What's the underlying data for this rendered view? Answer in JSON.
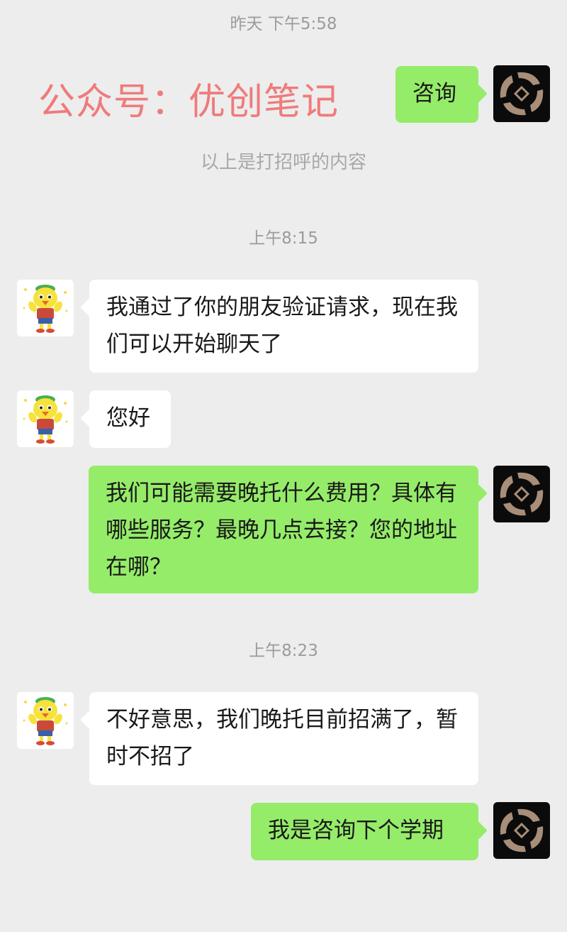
{
  "timestamps": {
    "t1": "昨天 下午5:58",
    "t2": "上午8:15",
    "t3": "上午8:23"
  },
  "watermark": "公众号：优创笔记",
  "system_note": "以上是打招呼的内容",
  "messages": [
    {
      "side": "right",
      "text": "咨询"
    },
    {
      "side": "left",
      "text": "我通过了你的朋友验证请求，现在我们可以开始聊天了"
    },
    {
      "side": "left",
      "text": "您好"
    },
    {
      "side": "right",
      "text": "我们可能需要晚托什么费用？具体有哪些服务？最晚几点去接？您的地址在哪？"
    },
    {
      "side": "left",
      "text": "不好意思，我们晚托目前招满了，暂时不招了"
    },
    {
      "side": "right",
      "text": "我是咨询下个学期"
    }
  ],
  "avatars": {
    "self": "ninja-logo-icon",
    "contact": "cartoon-chick-mascot-icon"
  },
  "colors": {
    "background": "#ededed",
    "bubble_self": "#95ec69",
    "bubble_other": "#ffffff",
    "watermark": "#ef7b7b",
    "timestamp": "#9b9b9b"
  }
}
